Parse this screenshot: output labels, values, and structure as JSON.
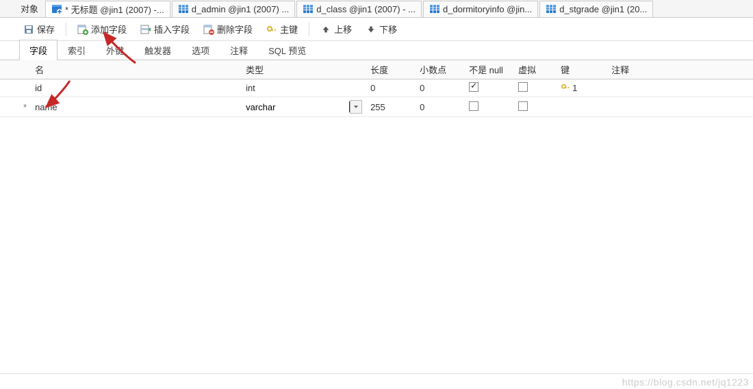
{
  "tabs": {
    "object_label": "对象",
    "items": [
      {
        "label": "* 无标题 @jin1 (2007) -...",
        "icon": "newtable-icon",
        "active": true
      },
      {
        "label": "d_admin @jin1 (2007) ...",
        "icon": "table-icon"
      },
      {
        "label": "d_class @jin1 (2007) - ...",
        "icon": "table-icon"
      },
      {
        "label": "d_dormitoryinfo @jin...",
        "icon": "table-icon"
      },
      {
        "label": "d_stgrade @jin1 (20...",
        "icon": "table-icon"
      }
    ]
  },
  "toolbar": {
    "save": "保存",
    "add_field": "添加字段",
    "insert_field": "插入字段",
    "delete_field": "删除字段",
    "primary_key": "主键",
    "move_up": "上移",
    "move_down": "下移"
  },
  "inner_tabs": {
    "fields": "字段",
    "indexes": "索引",
    "foreign_keys": "外键",
    "triggers": "触发器",
    "options": "选项",
    "comment": "注释",
    "sql_preview": "SQL 预览",
    "active": "fields"
  },
  "columns": {
    "name": "名",
    "type": "类型",
    "length": "长度",
    "decimals": "小数点",
    "not_null": "不是 null",
    "virtual": "虚拟",
    "key": "键",
    "comment": "注释"
  },
  "rows": [
    {
      "bullet": "",
      "name": "id",
      "type": "int",
      "length": "0",
      "decimals": "0",
      "not_null": true,
      "virtual": false,
      "key": "1",
      "is_key": true
    },
    {
      "bullet": "*",
      "name": "name",
      "type": "varchar",
      "length": "255",
      "decimals": "0",
      "not_null": false,
      "virtual": false,
      "key": "",
      "is_key": false,
      "editing_type": true
    }
  ],
  "watermark": "https://blog.csdn.net/jq1223"
}
